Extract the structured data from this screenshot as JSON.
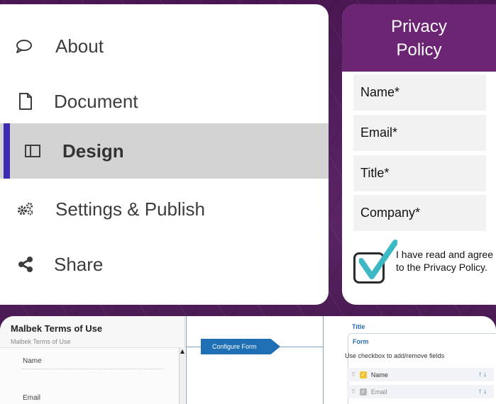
{
  "nav": {
    "items": [
      {
        "label": "About",
        "icon": "comment-icon"
      },
      {
        "label": "Document",
        "icon": "document-icon"
      },
      {
        "label": "Design",
        "icon": "columns-icon",
        "active": true
      },
      {
        "label": "Settings & Publish",
        "icon": "gears-icon"
      },
      {
        "label": "Share",
        "icon": "share-icon"
      }
    ],
    "accent_color": "#3b2bb0",
    "active_bg": "#d3d3d3"
  },
  "privacy": {
    "title_line1": "Privacy",
    "title_line2": "Policy",
    "fields": [
      "Name*",
      "Email*",
      "Title*",
      "Company*"
    ],
    "consent_text": "I have read and agree to the Privacy Policy.",
    "consent_checked": true,
    "header_color": "#6b2573",
    "check_color": "#3cb7c4"
  },
  "builder": {
    "doc_title": "Malbek Terms of Use",
    "doc_subtitle": "Malbek Terms of Use",
    "form_fields": [
      "Name",
      "Email"
    ],
    "configure_button": "Configure Form",
    "panel_title": "Title",
    "form_tab": "Form",
    "hint": "Use checkbox to add/remove fields",
    "field_list": [
      {
        "label": "Name",
        "checked": true
      },
      {
        "label": "Email",
        "checked": true
      }
    ],
    "button_color": "#1f6fb4"
  }
}
